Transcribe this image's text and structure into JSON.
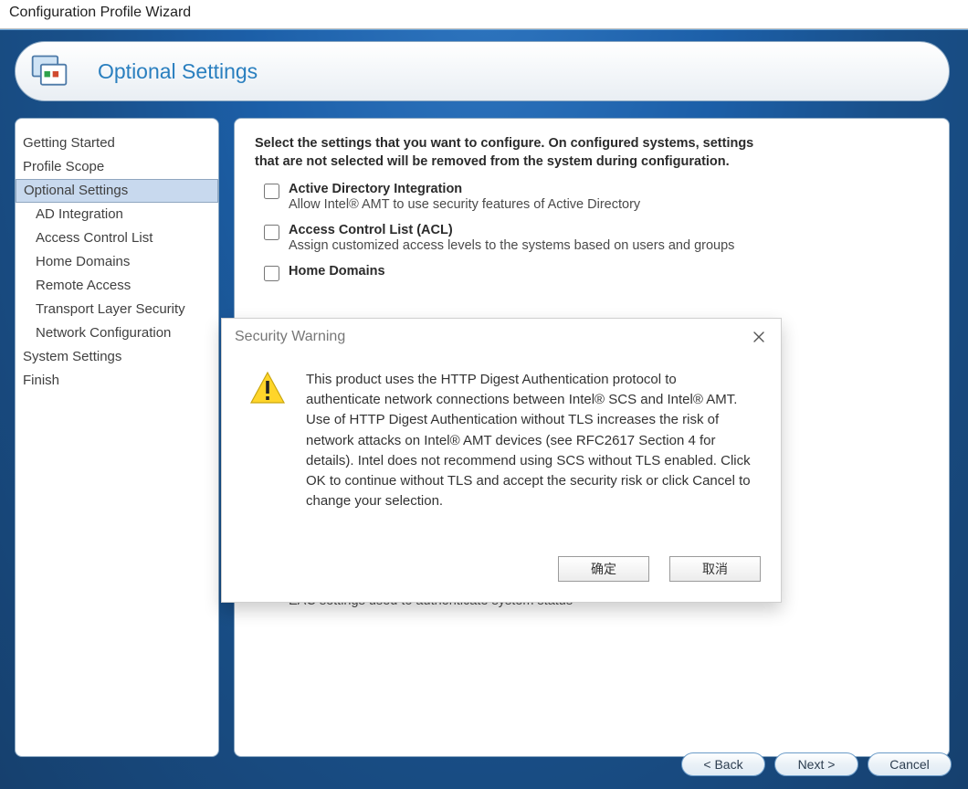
{
  "window": {
    "title": "Configuration Profile Wizard"
  },
  "header": {
    "title": "Optional Settings"
  },
  "sidebar": {
    "items": [
      {
        "label": "Getting Started",
        "sub": false,
        "selected": false
      },
      {
        "label": "Profile Scope",
        "sub": false,
        "selected": false
      },
      {
        "label": "Optional Settings",
        "sub": false,
        "selected": true
      },
      {
        "label": "AD Integration",
        "sub": true,
        "selected": false
      },
      {
        "label": "Access Control List",
        "sub": true,
        "selected": false
      },
      {
        "label": "Home Domains",
        "sub": true,
        "selected": false
      },
      {
        "label": "Remote Access",
        "sub": true,
        "selected": false
      },
      {
        "label": "Transport Layer Security",
        "sub": true,
        "selected": false
      },
      {
        "label": "Network Configuration",
        "sub": true,
        "selected": false
      },
      {
        "label": "System Settings",
        "sub": false,
        "selected": false
      },
      {
        "label": "Finish",
        "sub": false,
        "selected": false
      }
    ]
  },
  "content": {
    "intro_line1": "Select the settings that you want to configure. On configured systems, settings",
    "intro_line2": "that are not selected will be removed from the system during configuration.",
    "options": [
      {
        "title": "Active Directory Integration",
        "desc": "Allow Intel® AMT to use security features of Active Directory"
      },
      {
        "title": "Access Control List (ACL)",
        "desc": "Assign customized access levels to the systems based on users and groups"
      },
      {
        "title": "Home Domains",
        "desc": ""
      }
    ],
    "orphan_desc": "EAC settings used to authenticate system status"
  },
  "modal": {
    "title": "Security Warning",
    "body": "This product uses the HTTP Digest Authentication protocol to authenticate network connections between Intel® SCS and Intel® AMT. Use of HTTP Digest Authentication without TLS increases the risk of network attacks on Intel® AMT devices (see RFC2617 Section 4 for details). Intel does not recommend using SCS without TLS enabled. Click OK to continue without TLS and accept the security risk or click Cancel to change your selection.",
    "ok_label": "确定",
    "cancel_label": "取消"
  },
  "footer": {
    "back_label": "< Back",
    "next_label": "Next >",
    "cancel_label": "Cancel"
  }
}
